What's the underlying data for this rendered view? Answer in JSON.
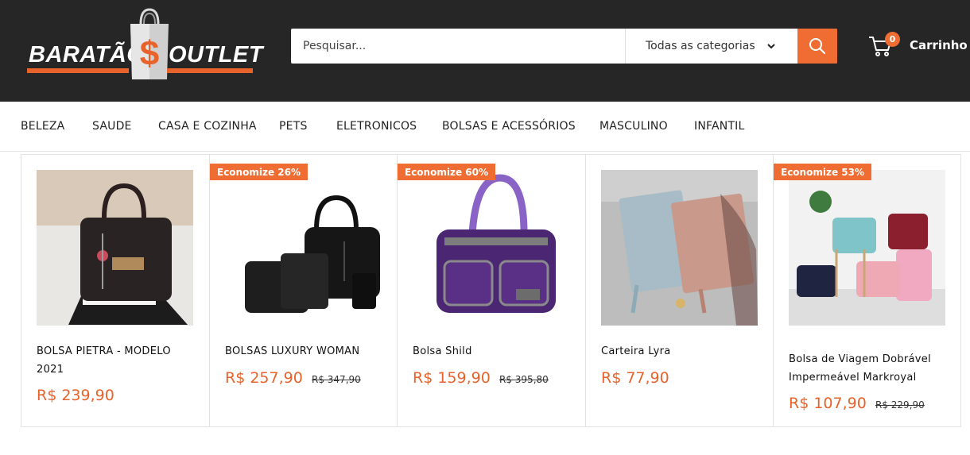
{
  "header": {
    "logo": {
      "word_left": "BARATÃO",
      "word_right": "OUTLET",
      "bag_symbol": "$"
    },
    "search": {
      "placeholder": "Pesquisar...",
      "value": "",
      "category": "Todas as categorias"
    },
    "cart": {
      "label": "Carrinho",
      "count": "0"
    }
  },
  "nav": {
    "items": [
      "BELEZA",
      "SAUDE",
      "CASA E COZINHA",
      "PETS",
      "ELETRONICOS",
      "BOLSAS E ACESSÓRIOS",
      "MASCULINO",
      "INFANTIL"
    ]
  },
  "products": [
    {
      "title": "BOLSA PIETRA - MODELO 2021",
      "price": "R$ 239,90",
      "old_price": "",
      "badge": ""
    },
    {
      "title": "BOLSAS LUXURY WOMAN",
      "price": "R$ 257,90",
      "old_price": "R$ 347,90",
      "badge": "Economize 26%"
    },
    {
      "title": "Bolsa Shild",
      "price": "R$ 159,90",
      "old_price": "R$ 395,80",
      "badge": "Economize 60%"
    },
    {
      "title": "Carteira Lyra",
      "price": "R$ 77,90",
      "old_price": "",
      "badge": ""
    },
    {
      "title": "Bolsa de Viagem Dobrável Impermeável Markroyal",
      "price": "R$ 107,90",
      "old_price": "R$ 229,90",
      "badge": "Economize 53%"
    }
  ],
  "icons": {
    "search": "search-icon",
    "chevron": "chevron-down-icon",
    "cart": "cart-icon"
  },
  "colors": {
    "accent": "#ef6d32",
    "header_bg": "#262626",
    "price": "#e8632b"
  }
}
